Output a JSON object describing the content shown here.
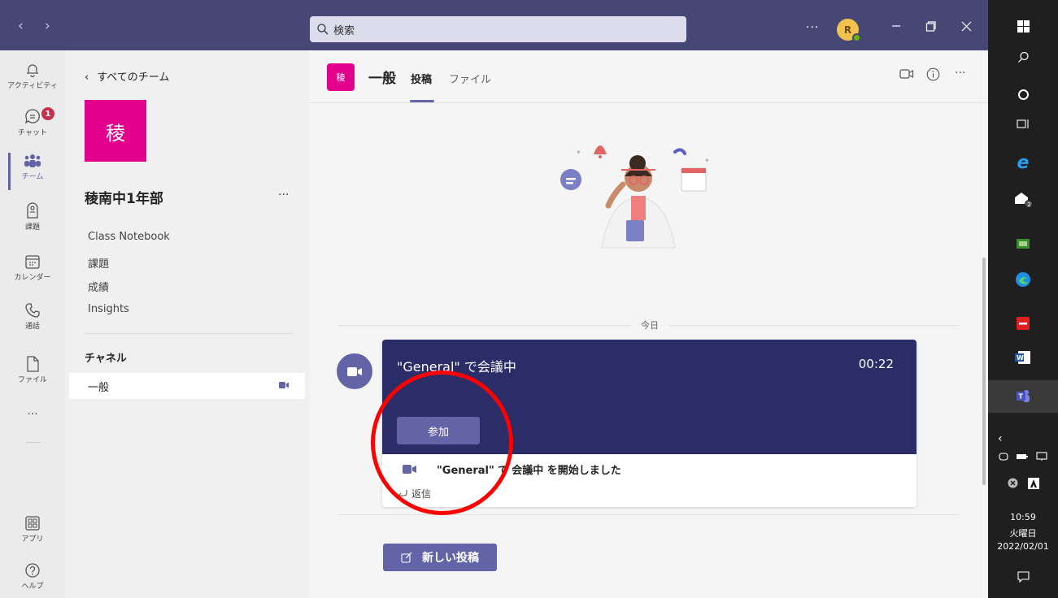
{
  "titlebar": {
    "search_placeholder": "検索",
    "more_label": "···",
    "avatar_initial": "R"
  },
  "rail": {
    "items": [
      {
        "label": "アクティビティ",
        "icon": "bell-icon"
      },
      {
        "label": "チャット",
        "icon": "chat-icon",
        "badge": "1"
      },
      {
        "label": "チーム",
        "icon": "teams-icon"
      },
      {
        "label": "課題",
        "icon": "assignments-icon"
      },
      {
        "label": "カレンダー",
        "icon": "calendar-icon"
      },
      {
        "label": "通話",
        "icon": "phone-icon"
      },
      {
        "label": "ファイル",
        "icon": "file-icon"
      }
    ],
    "more_label": "···",
    "apps_label": "アプリ",
    "help_label": "ヘルプ"
  },
  "panel": {
    "back_label": "すべてのチーム",
    "team_tile": "稜",
    "team_name": "稜南中1年部",
    "team_more": "···",
    "links": [
      "Class Notebook",
      "課題",
      "成績",
      "Insights"
    ],
    "channels_header": "チャネル",
    "channels": [
      {
        "name": "一般",
        "active": true
      }
    ]
  },
  "channel": {
    "avatar": "稜",
    "name": "一般",
    "tabs": [
      "投稿",
      "ファイル"
    ],
    "active_tab": "投稿",
    "more_label": "···"
  },
  "feed": {
    "day_label": "今日",
    "meeting_card": {
      "title": "\"General\" で会議中",
      "timer": "00:22",
      "join_label": "参加",
      "event_quote": "\"General\" で",
      "event_rest": "会議中 を開始しました",
      "reply_label": "返信"
    },
    "new_post_label": "新しい投稿"
  },
  "taskbar": {
    "time": "10:59",
    "weekday": "火曜日",
    "date": "2022/02/01"
  },
  "colors": {
    "titlebar": "#464775",
    "accent": "#6264a7",
    "meeting_banner": "#2b2d68",
    "team_tile": "#e3008c",
    "annotation_circle": "#ff0000"
  }
}
